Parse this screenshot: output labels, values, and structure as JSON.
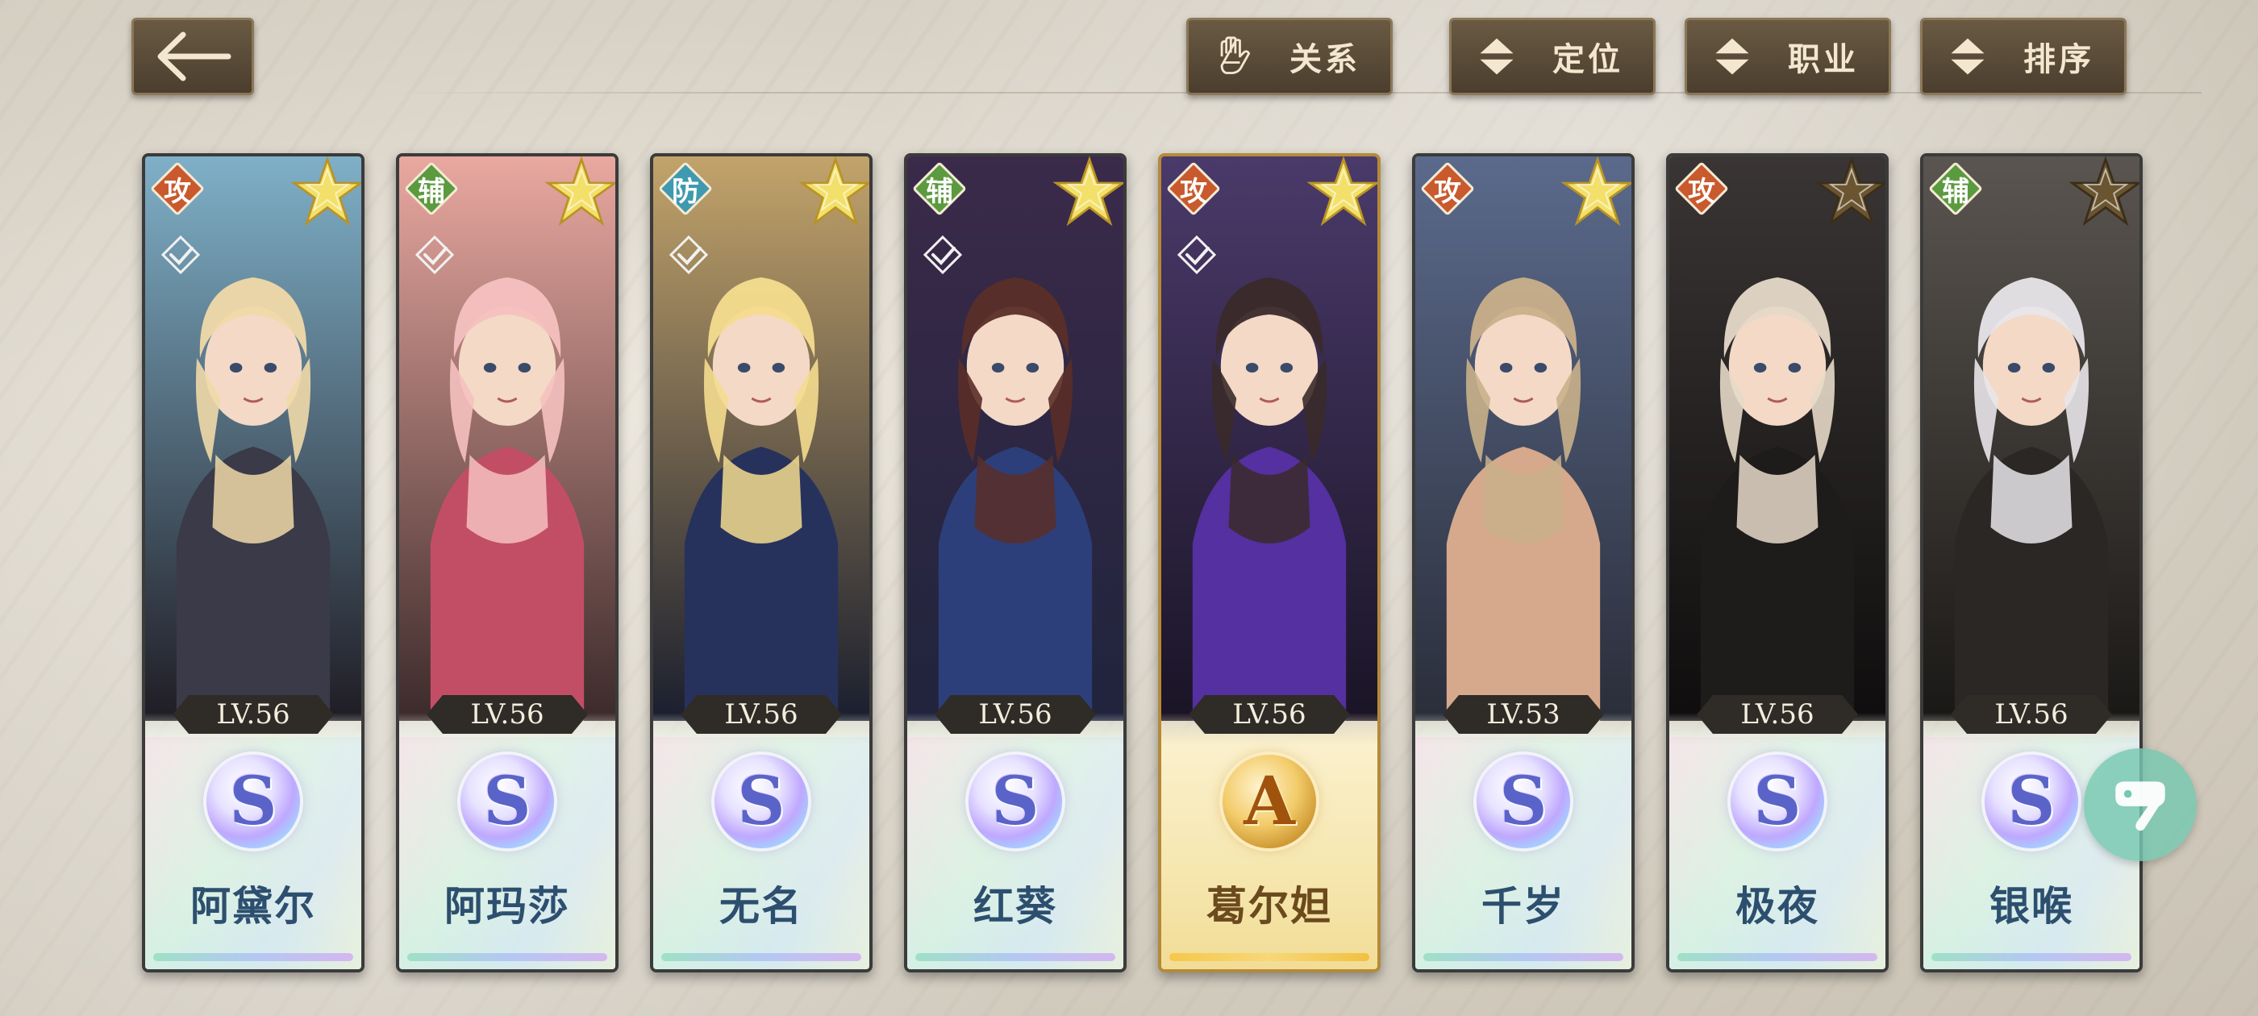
{
  "header": {
    "back_icon": "back-arrow-icon",
    "filters": [
      {
        "label": "关系",
        "icon": "gauntlet-icon"
      },
      {
        "label": "定位",
        "icon": "sort-arrows-icon"
      },
      {
        "label": "职业",
        "icon": "sort-arrows-icon"
      },
      {
        "label": "排序",
        "icon": "sort-arrows-icon"
      }
    ]
  },
  "colors": {
    "role_attack": "#c85a2e",
    "role_support": "#5b9a3f",
    "role_defense": "#3f9ab0",
    "button_bg": "#5a4b37",
    "button_text": "#f3e8cf"
  },
  "characters": [
    {
      "name": "阿黛尔",
      "role": "攻",
      "level": "LV.56",
      "rarity": "S",
      "stars": "star-gold-icon",
      "class_icon": "class-check-icon"
    },
    {
      "name": "阿玛莎",
      "role": "辅",
      "level": "LV.56",
      "rarity": "S",
      "stars": "star-gold-icon",
      "class_icon": "class-check-icon"
    },
    {
      "name": "无名",
      "role": "防",
      "level": "LV.56",
      "rarity": "S",
      "stars": "star-gold-icon",
      "class_icon": "class-check-icon"
    },
    {
      "name": "红葵",
      "role": "辅",
      "level": "LV.56",
      "rarity": "S",
      "stars": "star-gold-icon",
      "class_icon": "class-check-icon"
    },
    {
      "name": "葛尔妲",
      "role": "攻",
      "level": "LV.56",
      "rarity": "A",
      "stars": "star-gold-icon",
      "class_icon": "class-check-icon"
    },
    {
      "name": "千岁",
      "role": "攻",
      "level": "LV.53",
      "rarity": "S",
      "stars": "star-gold-icon",
      "class_icon": "none"
    },
    {
      "name": "极夜",
      "role": "攻",
      "level": "LV.56",
      "rarity": "S",
      "stars": "star-dark-icon",
      "class_icon": "none"
    },
    {
      "name": "银喉",
      "role": "辅",
      "level": "LV.56",
      "rarity": "S",
      "stars": "star-dark-icon",
      "class_icon": "none"
    }
  ],
  "float_button": {
    "icon": "gamepad-assistant-icon"
  }
}
